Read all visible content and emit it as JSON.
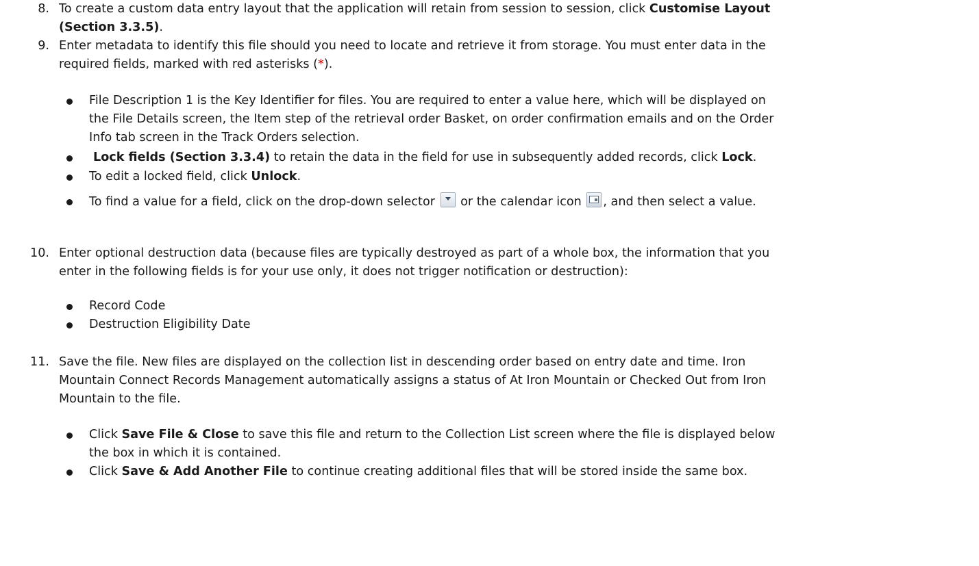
{
  "steps": {
    "s8": {
      "number": "8.",
      "line1": "To create a custom data entry layout that the application will retain from session to session, click ",
      "line1_bold": "Customise Layout",
      "line2_bold": "(Section 3.3.5)",
      "line2_end": "."
    },
    "s9": {
      "number": "9.",
      "line1": "Enter metadata to identify this file should you need to locate and retrieve it from storage. You must enter data in the",
      "line2_pre": "required fields, marked with red asterisks (",
      "asterisk": "*",
      "line2_post": ").",
      "b1_line1": "File Description 1 is the Key Identifier for files. You are required to enter a value here, which will be displayed on",
      "b1_line2": "the File Details screen, the Item step of the retrieval order Basket, on order confirmation emails and on the Order",
      "b1_line3": "Info tab screen in the Track Orders selection.",
      "b2_bold": "Lock fields (Section 3.3.4)",
      "b2_mid": " to retain the data in the field for use in subsequently added records, click ",
      "b2_bold2": "Lock",
      "b2_end": ".",
      "b3_pre": "To edit a locked field, click ",
      "b3_bold": "Unlock",
      "b3_end": ".",
      "b4_pre": "To find a value for a field, click on the drop-down selector ",
      "b4_dd_icon": "dropdown-selector-icon",
      "b4_mid": " or the calendar icon ",
      "b4_cal_icon": "calendar-icon",
      "b4_end": ", and then select a value."
    },
    "s10": {
      "number": "10.",
      "line1": "Enter optional destruction data (because files are typically destroyed as part of a whole box, the information that you",
      "line2": "enter in the following fields is for your use only, it does not trigger notification or destruction):",
      "b1": "Record Code",
      "b2": "Destruction Eligibility Date"
    },
    "s11": {
      "number": "11.",
      "line1": "Save the file.  New files are displayed on the collection list in descending order based on entry date and time.  Iron",
      "line2": "Mountain Connect Records Management automatically assigns a status of At Iron Mountain or Checked Out from Iron",
      "line3": "Mountain to the file.",
      "b1_pre": "Click ",
      "b1_bold": "Save File & Close",
      "b1_line1_post": " to save this file and return to the Collection List screen where the file is displayed below",
      "b1_line2": "the box in which it is contained.",
      "b2_pre": "Click ",
      "b2_bold": "Save & Add Another File",
      "b2_post": " to continue creating additional files that will be stored inside the same box."
    }
  },
  "colors": {
    "text": "#1a1a1a",
    "required_asterisk": "#cc0000"
  }
}
